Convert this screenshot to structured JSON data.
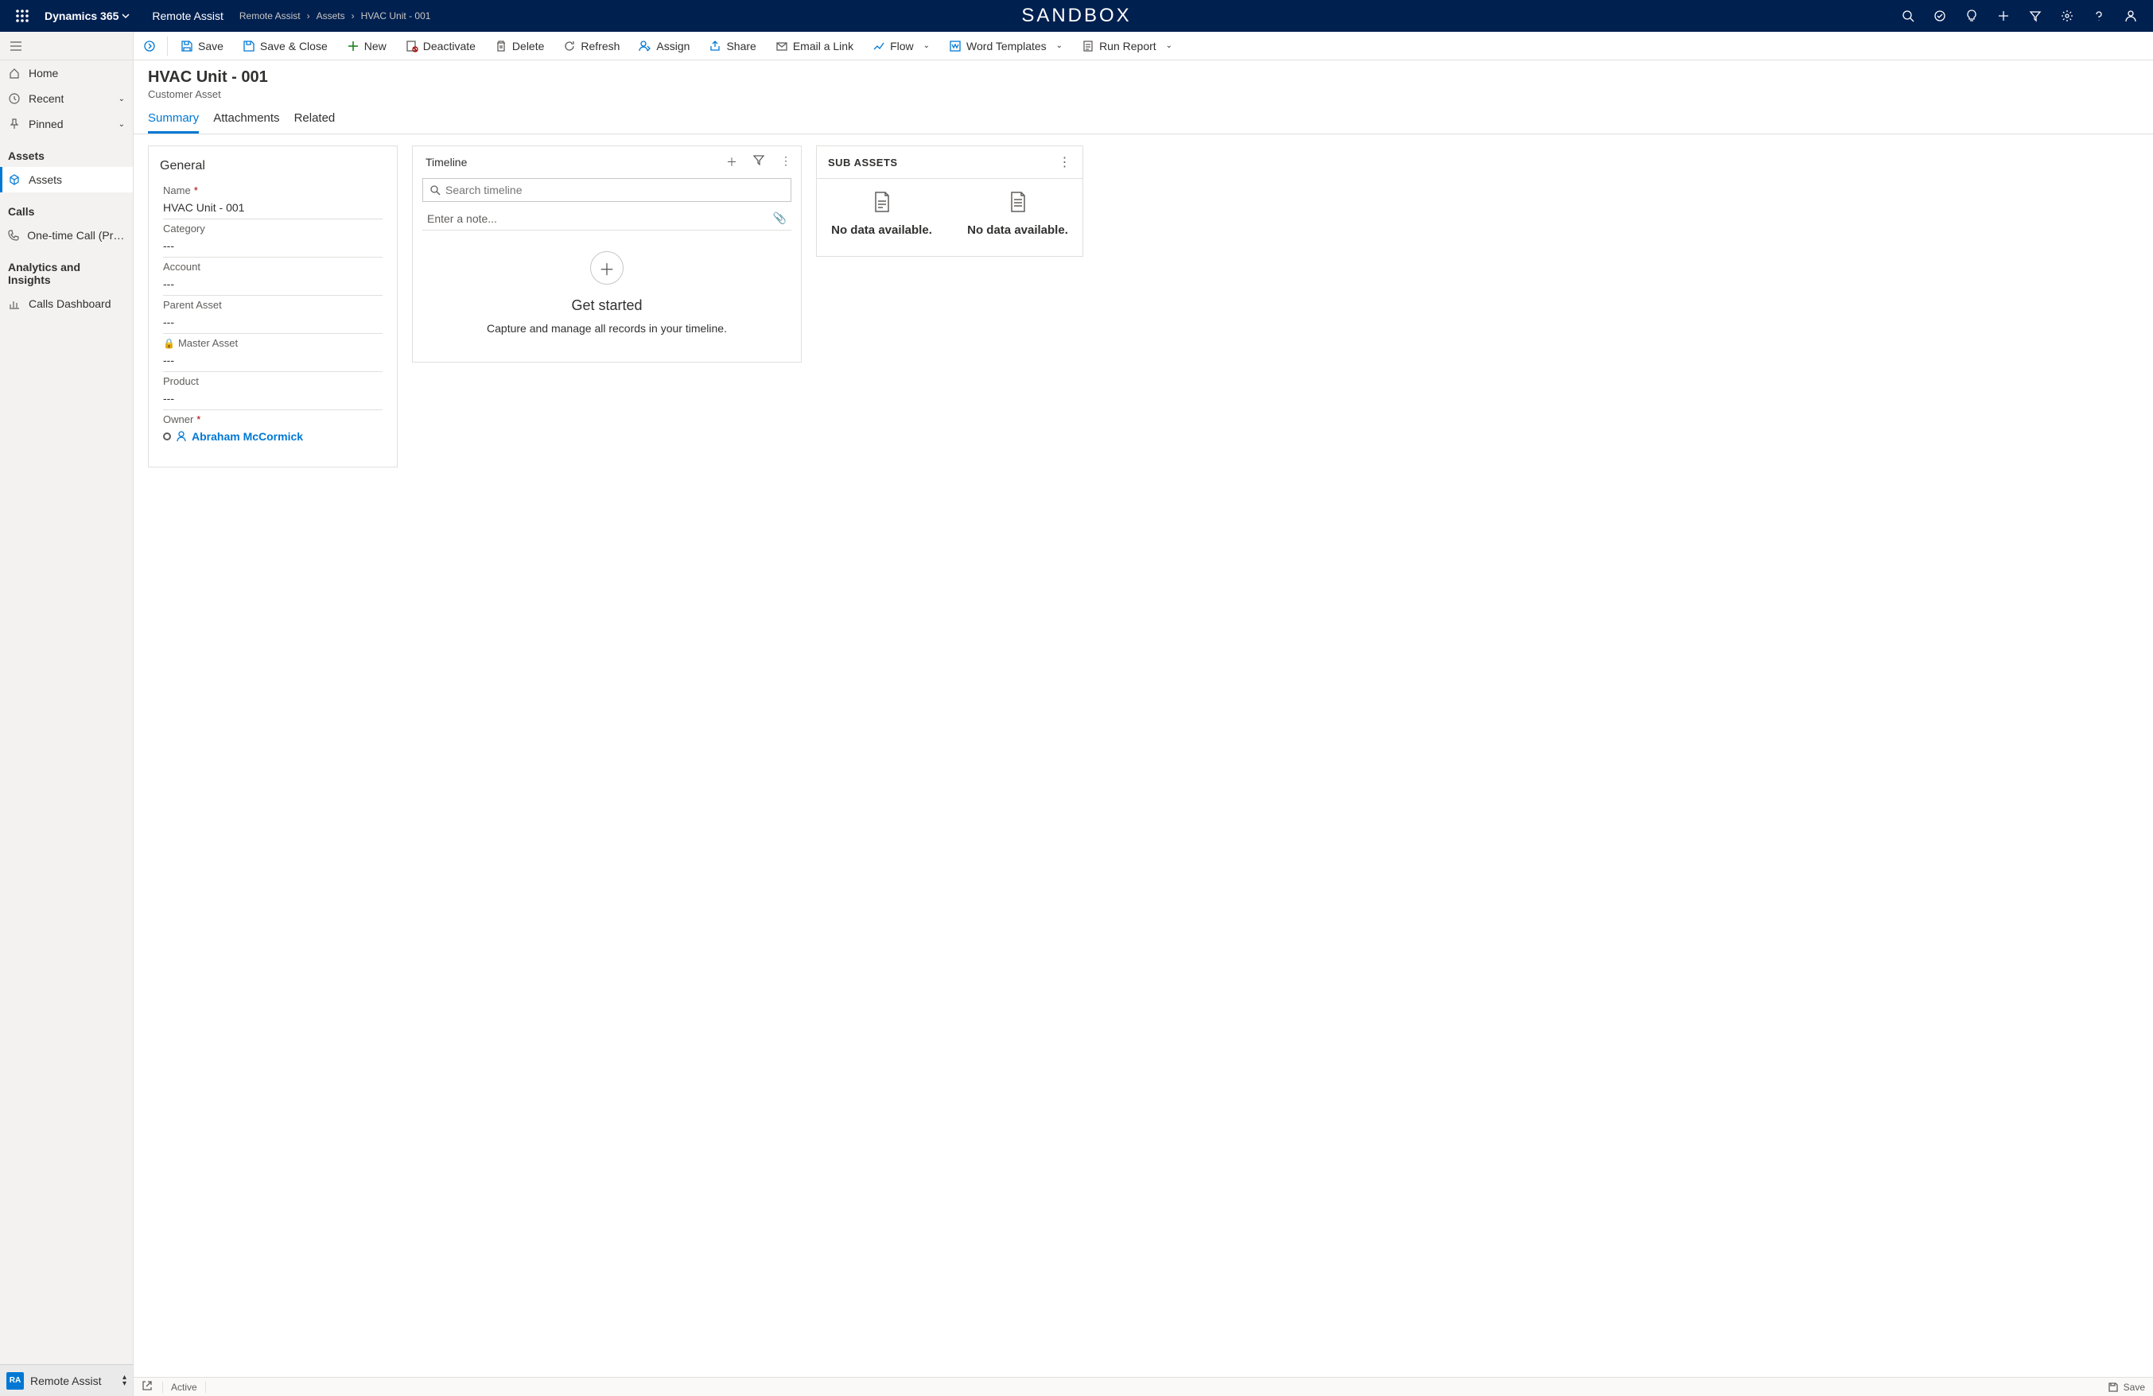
{
  "topbar": {
    "brand": "Dynamics 365",
    "app": "Remote Assist",
    "sandbox": "SANDBOX",
    "breadcrumbs": [
      "Remote Assist",
      "Assets",
      "HVAC Unit - 001"
    ]
  },
  "sidebar": {
    "home": "Home",
    "recent": "Recent",
    "pinned": "Pinned",
    "sections": {
      "assets": {
        "header": "Assets",
        "item": "Assets"
      },
      "calls": {
        "header": "Calls",
        "item": "One-time Call (Previ..."
      },
      "analytics": {
        "header": "Analytics and Insights",
        "item": "Calls Dashboard"
      }
    }
  },
  "appswitcher": {
    "badge": "RA",
    "label": "Remote Assist"
  },
  "cmdbar": {
    "save": "Save",
    "saveclose": "Save & Close",
    "new": "New",
    "deactivate": "Deactivate",
    "delete": "Delete",
    "refresh": "Refresh",
    "assign": "Assign",
    "share": "Share",
    "email": "Email a Link",
    "flow": "Flow",
    "word": "Word Templates",
    "report": "Run Report"
  },
  "record": {
    "title": "HVAC Unit - 001",
    "subtitle": "Customer Asset"
  },
  "tabs": {
    "summary": "Summary",
    "attachments": "Attachments",
    "related": "Related"
  },
  "general": {
    "title": "General",
    "name_label": "Name",
    "name_value": "HVAC Unit - 001",
    "category_label": "Category",
    "category_value": "---",
    "account_label": "Account",
    "account_value": "---",
    "parent_label": "Parent Asset",
    "parent_value": "---",
    "master_label": "Master Asset",
    "master_value": "---",
    "product_label": "Product",
    "product_value": "---",
    "owner_label": "Owner",
    "owner_value": "Abraham McCormick"
  },
  "timeline": {
    "title": "Timeline",
    "search_placeholder": "Search timeline",
    "note_placeholder": "Enter a note...",
    "getstarted": "Get started",
    "subtext": "Capture and manage all records in your timeline."
  },
  "subassets": {
    "title": "SUB ASSETS",
    "nodata1": "No data available.",
    "nodata2": "No data available."
  },
  "statusbar": {
    "status": "Active",
    "save": "Save"
  }
}
